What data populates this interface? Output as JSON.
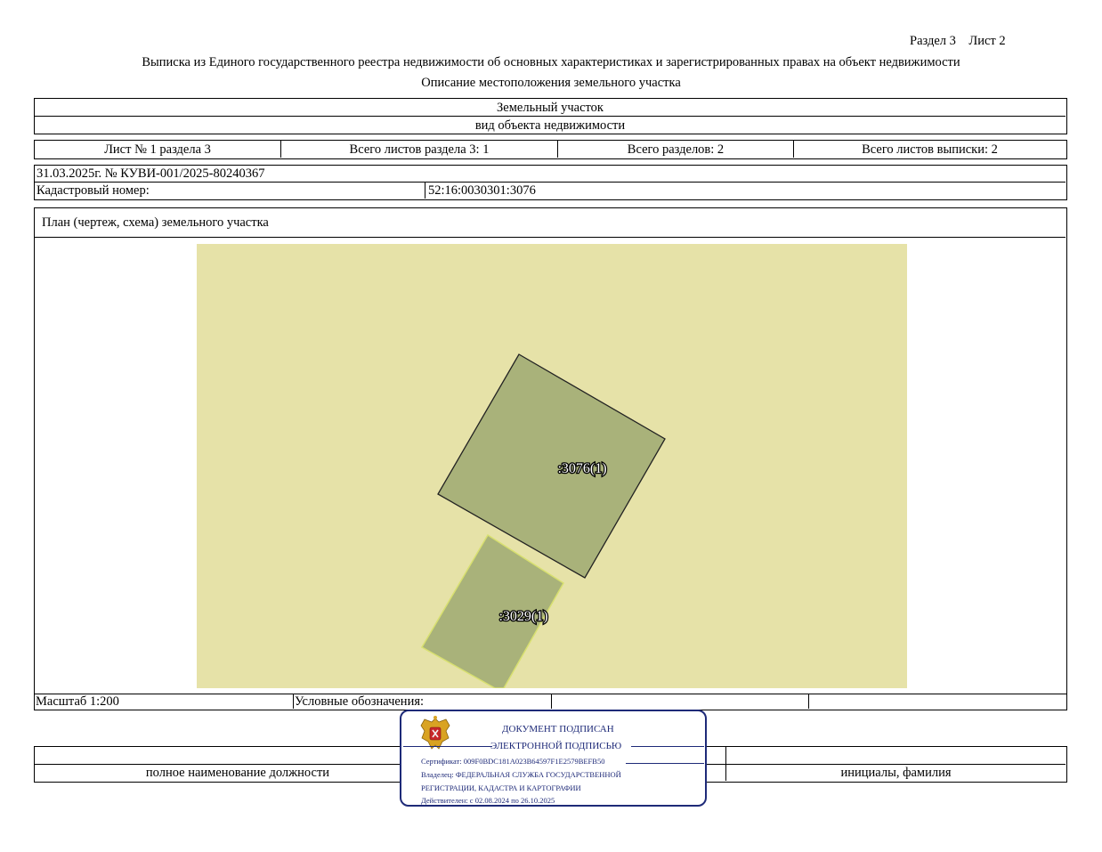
{
  "header": {
    "section_sheet": "Раздел 3    Лист 2",
    "title": "Выписка из Единого государственного реестра недвижимости об основных характеристиках и зарегистрированных правах на объект недвижимости",
    "subtitle": "Описание местоположения земельного участка"
  },
  "object": {
    "name": "Земельный участок",
    "kind_caption": "вид объекта недвижимости"
  },
  "sheets": {
    "sheet_no": "Лист № 1 раздела 3",
    "total_sheets_section": "Всего листов раздела 3: 1",
    "total_sections": "Всего разделов: 2",
    "total_sheets": "Всего листов выписки: 2"
  },
  "doc": {
    "date_number": "31.03.2025г. № КУВИ-001/2025-80240367",
    "cadastral_label": "Кадастровый номер:",
    "cadastral_value": "52:16:0030301:3076"
  },
  "plan": {
    "title": "План (чертеж, схема) земельного участка",
    "parcel_main_label": ":3076(1)",
    "parcel_neighbor_label": ":3029(1)",
    "colors": {
      "background": "#e6e2a8",
      "parcel": "#a9b27a"
    }
  },
  "legend": {
    "scale": "Масштаб 1:200",
    "legend_label": "Условные обозначения:"
  },
  "signature_row": {
    "position_caption": "полное наименование должности",
    "name_caption": "инициалы, фамилия"
  },
  "stamp": {
    "line1": "ДОКУМЕНТ ПОДПИСАН",
    "line2": "ЭЛЕКТРОННОЙ ПОДПИСЬЮ",
    "certificate": "Сертификат: 009F0BDC181A023B64597F1E2579BEFB50",
    "owner_line1": "Владелец: ФЕДЕРАЛЬНАЯ СЛУЖБА ГОСУДАРСТВЕННОЙ",
    "owner_line2": "РЕГИСТРАЦИИ, КАДАСТРА И КАРТОГРАФИИ",
    "valid": "Действителен: с 02.08.2024 по 26.10.2025",
    "emblem_icon": "coat-of-arms-icon"
  }
}
